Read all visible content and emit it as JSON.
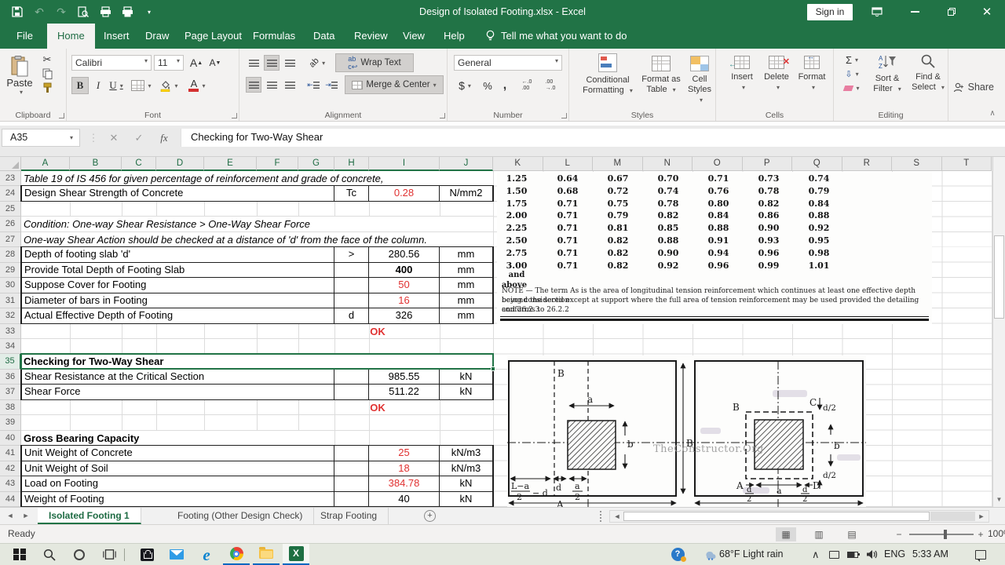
{
  "titlebar": {
    "title": "Design of Isolated Footing.xlsx - Excel",
    "sign_in": "Sign in"
  },
  "ribbon_tabs": [
    "File",
    "Home",
    "Insert",
    "Draw",
    "Page Layout",
    "Formulas",
    "Data",
    "Review",
    "View",
    "Help"
  ],
  "tell_me": "Tell me what you want to do",
  "share_label": "Share",
  "ribbon": {
    "paste": "Paste",
    "font_name": "Calibri",
    "font_size": "11",
    "wrap_text": "Wrap Text",
    "merge_center": "Merge & Center",
    "number_format": "General",
    "cond1": "Conditional",
    "cond2": "Formatting",
    "ft1": "Format as",
    "ft2": "Table",
    "cs1": "Cell",
    "cs2": "Styles",
    "insert": "Insert",
    "delete": "Delete",
    "format": "Format",
    "sort1": "Sort &",
    "sort2": "Filter",
    "find1": "Find &",
    "find2": "Select",
    "groups": {
      "clipboard": "Clipboard",
      "font": "Font",
      "alignment": "Alignment",
      "number": "Number",
      "styles": "Styles",
      "cells": "Cells",
      "editing": "Editing"
    }
  },
  "formula_bar": {
    "name_box": "A35",
    "formula": "Checking for Two-Way Shear"
  },
  "grid": {
    "columns_left": [
      "A",
      "B",
      "C",
      "D",
      "E",
      "F",
      "G",
      "H",
      "I",
      "J"
    ],
    "columns_right": [
      "K",
      "L",
      "M",
      "N",
      "O",
      "P",
      "Q",
      "R",
      "S",
      "T"
    ],
    "rows": [
      {
        "num": 23,
        "type": "note",
        "label": "Table 19 of IS 456 for given percentage of reinforcement and grade of concrete,"
      },
      {
        "num": 24,
        "type": "data",
        "label": "Design Shear Strength of Concrete",
        "sym": "Tc",
        "value": "0.28",
        "unit": "N/mm2",
        "value_red": true
      },
      {
        "num": 25,
        "type": "empty"
      },
      {
        "num": 26,
        "type": "note",
        "label": "Condition: One-way Shear Resistance > One-Way Shear Force"
      },
      {
        "num": 27,
        "type": "note",
        "label": "One-way Shear Action should be checked at a distance of 'd' from the face of the column."
      },
      {
        "num": 28,
        "type": "data",
        "label": "Depth of footing slab 'd'",
        "sym": ">",
        "value": "280.56",
        "unit": "mm"
      },
      {
        "num": 29,
        "type": "data",
        "label": "Provide Total Depth of Footing Slab",
        "sym": "",
        "value": "400",
        "unit": "mm",
        "value_bold": true
      },
      {
        "num": 30,
        "type": "data",
        "label": "Suppose Cover for Footing",
        "sym": "",
        "value": "50",
        "unit": "mm",
        "value_red": true
      },
      {
        "num": 31,
        "type": "data",
        "label": "Diameter of bars in Footing",
        "sym": "",
        "value": "16",
        "unit": "mm",
        "value_red": true
      },
      {
        "num": 32,
        "type": "data",
        "label": "Actual Effective Depth of Footing",
        "sym": "d",
        "value": "326",
        "unit": "mm"
      },
      {
        "num": 33,
        "type": "status",
        "status": "OK"
      },
      {
        "num": 34,
        "type": "empty"
      },
      {
        "num": 35,
        "type": "head",
        "label": "Checking for Two-Way Shear",
        "selected": true
      },
      {
        "num": 36,
        "type": "data",
        "label": "Shear Resistance at the Critical Section",
        "sym": "",
        "value": "985.55",
        "unit": "kN"
      },
      {
        "num": 37,
        "type": "data",
        "label": "Shear Force",
        "sym": "",
        "value": "511.22",
        "unit": "kN"
      },
      {
        "num": 38,
        "type": "status",
        "status": "OK"
      },
      {
        "num": 39,
        "type": "empty"
      },
      {
        "num": 40,
        "type": "head",
        "label": "Gross Bearing Capacity"
      },
      {
        "num": 41,
        "type": "data",
        "label": "Unit Weight of Concrete",
        "sym": "",
        "value": "25",
        "unit": "kN/m3",
        "value_red": true
      },
      {
        "num": 42,
        "type": "data",
        "label": "Unit Weight of Soil",
        "sym": "",
        "value": "18",
        "unit": "kN/m3",
        "value_red": true
      },
      {
        "num": 43,
        "type": "data",
        "label": "Load on Footing",
        "sym": "",
        "value": "384.78",
        "unit": "kN",
        "value_red": true
      },
      {
        "num": 44,
        "type": "data",
        "label": "Weight of Footing",
        "sym": "",
        "value": "40",
        "unit": "kN"
      }
    ]
  },
  "is456": {
    "rows": [
      [
        "1.25",
        "0.64",
        "0.67",
        "0.70",
        "0.71",
        "0.73",
        "0.74"
      ],
      [
        "1.50",
        "0.68",
        "0.72",
        "0.74",
        "0.76",
        "0.78",
        "0.79"
      ],
      [
        "1.75",
        "0.71",
        "0.75",
        "0.78",
        "0.80",
        "0.82",
        "0.84"
      ],
      [
        "2.00",
        "0.71",
        "0.79",
        "0.82",
        "0.84",
        "0.86",
        "0.88"
      ],
      [
        "2.25",
        "0.71",
        "0.81",
        "0.85",
        "0.88",
        "0.90",
        "0.92"
      ],
      [
        "2.50",
        "0.71",
        "0.82",
        "0.88",
        "0.91",
        "0.93",
        "0.95"
      ],
      [
        "2.75",
        "0.71",
        "0.82",
        "0.90",
        "0.94",
        "0.96",
        "0.98"
      ],
      [
        "3.00",
        "0.71",
        "0.82",
        "0.92",
        "0.96",
        "0.99",
        "1.01"
      ]
    ],
    "suffix1": "and",
    "suffix2": "above",
    "note1": "NOTE — The term As is the area of longitudinal tension reinforcement which continues at least one effective depth beyond the section",
    "note2": "being considered except at support where the full area of tension reinforcement may be used provided the detailing conforms to 26.2.2",
    "note3": "and 26.2.3"
  },
  "diagram": {
    "labels": {
      "B": "B",
      "A": "A",
      "C": "C",
      "D": "D",
      "a": "a",
      "b": "b",
      "d": "d",
      "two": "2",
      "d_half": "d/2",
      "L_minus_a": "L−a",
      "minus_d": "− d",
      "watermark": "TheConstructor.Org"
    }
  },
  "sheet_tabs": {
    "active": "Isolated Footing 1",
    "tab2": "Footing (Other Design Check)",
    "tab3": "Strap Footing"
  },
  "status_bar": {
    "mode": "Ready",
    "zoom": "100%"
  },
  "taskbar": {
    "weather": "68°F  Light rain",
    "lang": "ENG",
    "time": "5:33 AM"
  }
}
